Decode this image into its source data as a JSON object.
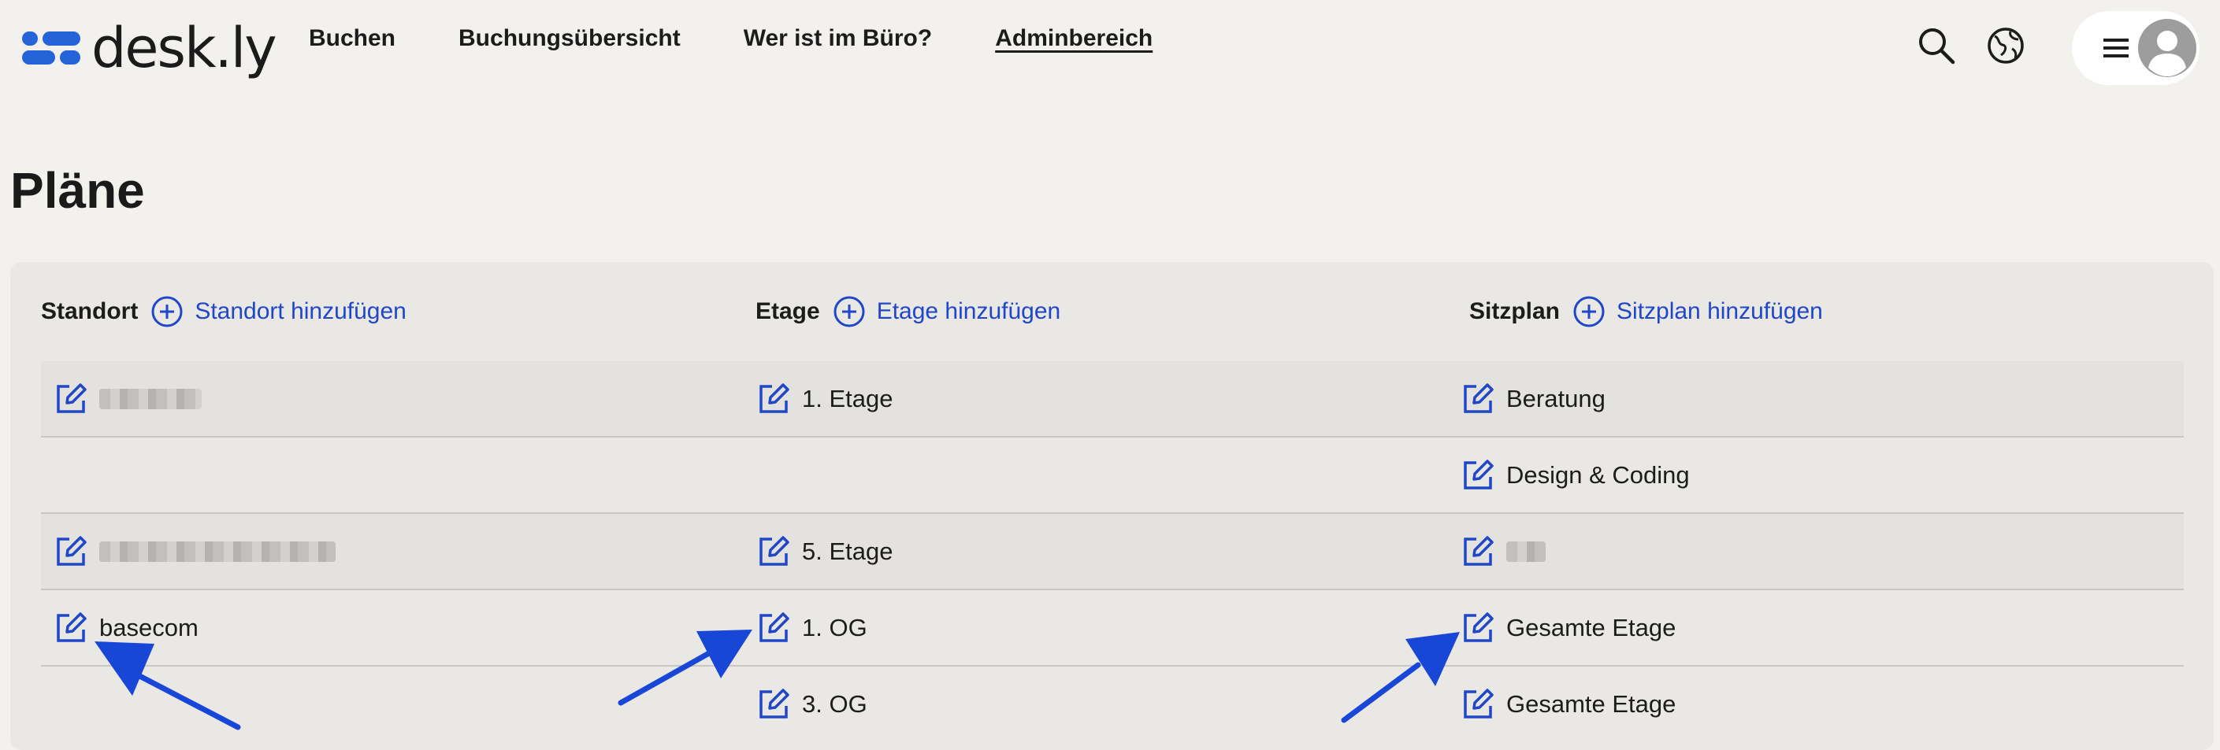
{
  "brand": {
    "logo_text": "desk.ly",
    "accent": "#2563d9"
  },
  "nav": {
    "items": [
      {
        "label": "Buchen"
      },
      {
        "label": "Buchungsübersicht"
      },
      {
        "label": "Wer ist im Büro?"
      },
      {
        "label": "Adminbereich",
        "active": true
      }
    ]
  },
  "header_icons": [
    "search-icon",
    "globe-icon",
    "menu-icon",
    "user-avatar-icon"
  ],
  "page": {
    "title": "Pläne"
  },
  "columns": [
    {
      "label": "Standort",
      "add_label": "Standort hinzufügen"
    },
    {
      "label": "Etage",
      "add_label": "Etage hinzufügen"
    },
    {
      "label": "Sitzplan",
      "add_label": "Sitzplan hinzufügen"
    }
  ],
  "rows": [
    {
      "standort": "",
      "etage": "1. Etage",
      "sitzplan": "Beratung"
    },
    {
      "standort": "",
      "etage": "",
      "sitzplan": "Design & Coding"
    },
    {
      "standort": "",
      "etage": "5. Etage",
      "sitzplan": ""
    },
    {
      "standort": "basecom",
      "etage": "1. OG",
      "sitzplan": "Gesamte Etage"
    },
    {
      "standort": "",
      "etage": "3. OG",
      "sitzplan": "Gesamte Etage"
    }
  ],
  "colors": {
    "link": "#1f47c8",
    "arrow": "#1846d6",
    "background": "#f2f1ee"
  }
}
